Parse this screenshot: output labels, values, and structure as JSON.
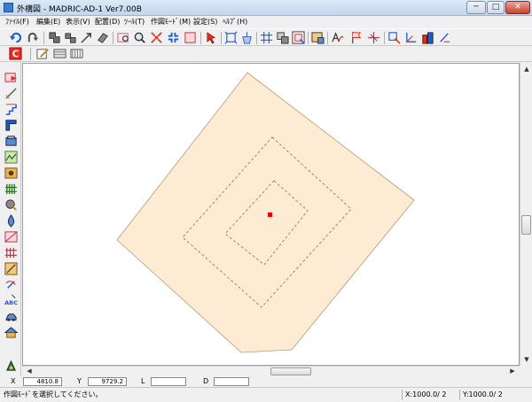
{
  "window": {
    "title": "外構図 - MADRIC-AD-1 Ver7.00B",
    "minimize": "─",
    "maximize": "□",
    "close": "✕"
  },
  "menu": {
    "items": [
      {
        "label": "ﾌｧｲﾙ(F)",
        "name": "file"
      },
      {
        "label": "編集(E)",
        "name": "edit"
      },
      {
        "label": "表示(V)",
        "name": "view"
      },
      {
        "label": "配置(D)",
        "name": "place"
      },
      {
        "label": "ﾂｰﾙ(T)",
        "name": "tool"
      },
      {
        "label": "作図ﾓｰﾄﾞ(M)",
        "name": "draw-mode"
      },
      {
        "label": "設定(S)",
        "name": "settings"
      },
      {
        "label": "ﾍﾙﾌﾟ(H)",
        "name": "help"
      }
    ]
  },
  "toolbar": {
    "icons": [
      "undo-icon",
      "redo-icon",
      "copy-shape-icon",
      "move-shape-icon",
      "arrow-line-icon",
      "eraser-icon",
      "zoom-window-icon",
      "zoom-icon",
      "zoom-extents-icon",
      "zoom-fit-icon",
      "redraw-icon",
      "select-arrow-icon",
      "rectangle-select-icon",
      "measure-icon",
      "grid-icon",
      "layer-icon",
      "frame-icon",
      "image-icon",
      "text-style-icon",
      "flag-icon",
      "crosshair-icon",
      "lasso-icon",
      "corner-icon",
      "building-icon",
      "pen-icon"
    ],
    "row2": [
      "c-mode-icon",
      "draw-pencil-icon",
      "hatch-icon",
      "pattern-icon"
    ]
  },
  "left_toolbar": {
    "icons": [
      "place-object-icon",
      "draw-line-icon",
      "stair-icon",
      "wall-icon",
      "block-icon",
      "terrain-icon",
      "plant-icon",
      "fence-icon",
      "tree-icon",
      "water-icon",
      "slope-icon",
      "rail-icon",
      "edit-shape-icon",
      "rotate-icon",
      "text-abc-icon",
      "car-icon",
      "house-icon",
      "settings-tool-icon"
    ]
  },
  "coords": {
    "x_label": "X",
    "x_value": "4810.8",
    "y_label": "Y",
    "y_value": "9729.2",
    "l_label": "L",
    "l_value": "",
    "d_label": "D",
    "d_value": ""
  },
  "status": {
    "message": "作図ﾓｰﾄﾞを選択してください。",
    "x_scale": "X:1000.0/ 2",
    "y_scale": "Y:1000.0/ 2"
  },
  "colors": {
    "site_fill": "#fdebd3",
    "site_stroke": "#b89a7a",
    "dashed": "#8a7055",
    "marker": "#e60000"
  }
}
